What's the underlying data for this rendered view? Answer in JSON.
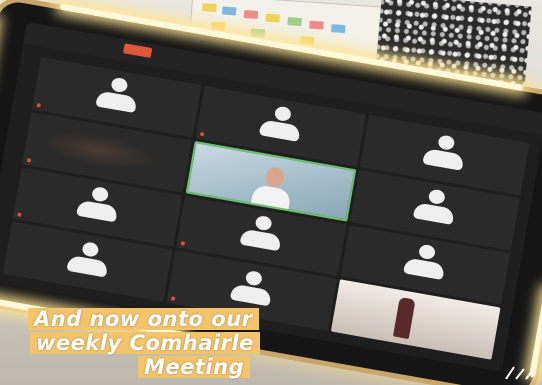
{
  "caption": {
    "line1": "And now onto our",
    "line2": "weekly Comhairle",
    "line3": "Meeting"
  },
  "colors": {
    "caption_bg": "#f4c46b",
    "ring_light": "#fff8d9",
    "leave_button": "#e0563b",
    "active_speaker_border": "#69c36d"
  },
  "meeting": {
    "tiles": [
      {
        "kind": "avatar"
      },
      {
        "kind": "avatar"
      },
      {
        "kind": "avatar"
      },
      {
        "kind": "dark-video"
      },
      {
        "kind": "active-video"
      },
      {
        "kind": "avatar"
      },
      {
        "kind": "avatar"
      },
      {
        "kind": "avatar"
      },
      {
        "kind": "avatar"
      },
      {
        "kind": "avatar"
      },
      {
        "kind": "avatar"
      },
      {
        "kind": "video"
      }
    ]
  }
}
